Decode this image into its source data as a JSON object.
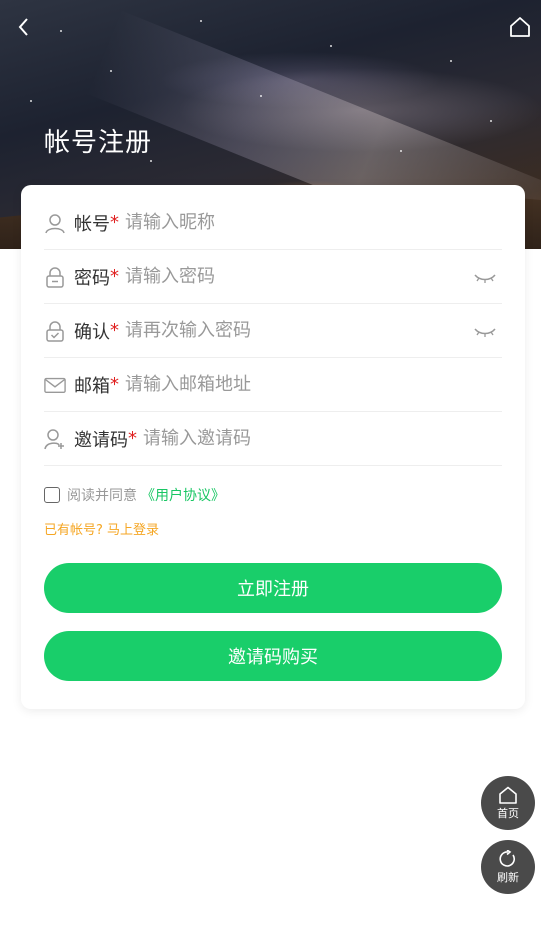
{
  "header": {
    "title": "帐号注册",
    "back_icon": "chevron-left-icon",
    "home_icon": "home-icon"
  },
  "form": {
    "fields": [
      {
        "label": "帐号",
        "required_mark": "*",
        "placeholder": "请输入昵称",
        "icon": "user-icon"
      },
      {
        "label": "密码",
        "required_mark": "*",
        "placeholder": "请输入密码",
        "icon": "lock-icon",
        "toggle_icon": "eye-closed-icon"
      },
      {
        "label": "确认",
        "required_mark": "*",
        "placeholder": "请再次输入密码",
        "icon": "lock-check-icon",
        "toggle_icon": "eye-closed-icon"
      },
      {
        "label": "邮箱",
        "required_mark": "*",
        "placeholder": "请输入邮箱地址",
        "icon": "mail-icon"
      },
      {
        "label": "邀请码",
        "required_mark": "*",
        "placeholder": "请输入邀请码",
        "icon": "user-add-icon"
      }
    ],
    "agreement_text": "阅读并同意",
    "agreement_link": "《用户协议》",
    "login_link": "已有帐号? 马上登录",
    "submit_label": "立即注册",
    "buy_label": "邀请码购买"
  },
  "floating": {
    "home_label": "首页",
    "refresh_label": "刷新"
  },
  "colors": {
    "accent": "#19ce6a",
    "required": "#e02020",
    "link_orange": "#f5a623",
    "fab_bg": "#4a4a4a"
  }
}
